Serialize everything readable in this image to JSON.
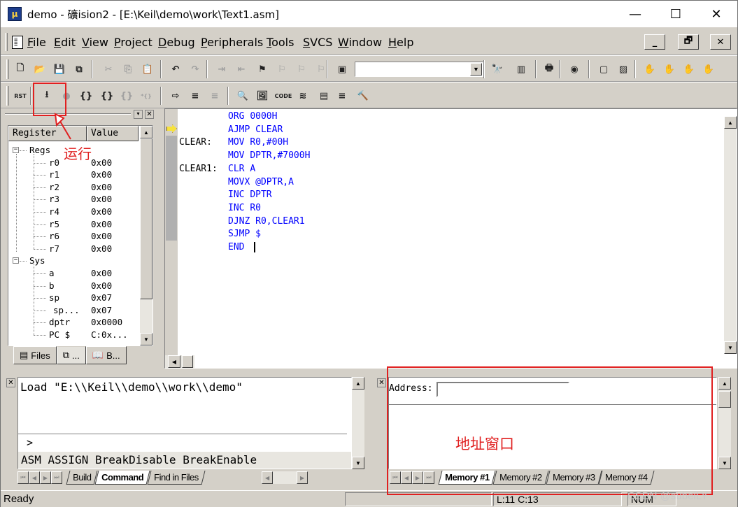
{
  "window": {
    "title": "demo  - 礦ision2 - [E:\\Keil\\demo\\work\\Text1.asm]",
    "icon_text": "µ",
    "minimize_glyph": "—",
    "maximize_glyph": "☐",
    "close_glyph": "✕"
  },
  "menu": {
    "items": [
      "File",
      "Edit",
      "View",
      "Project",
      "Debug",
      "Peripherals",
      "Tools",
      "SVCS",
      "Window",
      "Help"
    ],
    "mdi_buttons": [
      "_",
      "🗗",
      "✕"
    ]
  },
  "toolbar1": {
    "icons": [
      "new-file-icon",
      "open-folder-icon",
      "save-icon",
      "save-all-icon",
      "cut-icon",
      "copy-icon",
      "paste-icon",
      "undo-icon",
      "redo-icon",
      "indent-icon",
      "unindent-icon",
      "bookmark-toggle-icon",
      "bookmark-prev-icon",
      "bookmark-next-icon",
      "bookmark-clear-icon",
      "find-in-files-icon",
      "find-icon",
      "view-doc-icon",
      "print-icon",
      "debug-start-icon",
      "window-view-icon",
      "window-float-icon",
      "hand-icon",
      "hand-stop-icon",
      "hand-dis-icon",
      "hand-all-icon"
    ],
    "glyphs": [
      "🗋",
      "📂",
      "💾",
      "⧉",
      "✂",
      "⎘",
      "📋",
      "↶",
      "↷",
      "⇥",
      "⇤",
      "⚑",
      "⚐",
      "⚐",
      "⚐",
      "▣",
      "🔭",
      "▥",
      "🖶",
      "◉",
      "▢",
      "▨",
      "✋",
      "✋",
      "✋",
      "✋"
    ],
    "find_combo_value": ""
  },
  "toolbar2": {
    "icons": [
      "reset-cpu-icon",
      "run-icon",
      "stop-icon",
      "step-into-icon",
      "step-over-icon",
      "step-out-icon",
      "run-to-cursor-icon",
      "show-next-statement-icon",
      "enable-trace-icon",
      "view-trace-icon",
      "disassembly-icon",
      "watch-icon",
      "code-coverage-icon",
      "performance-icon",
      "memory-window-icon",
      "serial-window-icon",
      "toolbox-icon"
    ],
    "glyphs": [
      "RST",
      "⭳",
      "●",
      "{}",
      "{}",
      "{}",
      "*{}",
      "⇨",
      "≡",
      "≡",
      "🔍",
      "🖼",
      "CODE",
      "≋",
      "▤",
      "≡",
      "🔨"
    ]
  },
  "registers": {
    "columns": [
      "Register",
      "Value"
    ],
    "groups": [
      {
        "name": "Regs",
        "expander": "−",
        "items": [
          {
            "name": "r0",
            "value": "0x00"
          },
          {
            "name": "r1",
            "value": "0x00"
          },
          {
            "name": "r2",
            "value": "0x00"
          },
          {
            "name": "r3",
            "value": "0x00"
          },
          {
            "name": "r4",
            "value": "0x00"
          },
          {
            "name": "r5",
            "value": "0x00"
          },
          {
            "name": "r6",
            "value": "0x00"
          },
          {
            "name": "r7",
            "value": "0x00"
          }
        ]
      },
      {
        "name": "Sys",
        "expander": "−",
        "items": [
          {
            "name": "a",
            "value": "0x00"
          },
          {
            "name": "b",
            "value": "0x00"
          },
          {
            "name": "sp",
            "value": "0x07"
          },
          {
            "name": "sp...",
            "value": "0x07"
          },
          {
            "name": "dptr",
            "value": "0x0000"
          },
          {
            "name": "PC  $",
            "value": "C:0x..."
          }
        ]
      }
    ],
    "tabs": [
      {
        "label": "Files",
        "icon": "files-icon",
        "glyph": "▤"
      },
      {
        "label": "...",
        "icon": "registers-icon",
        "glyph": "⧉"
      },
      {
        "label": "B...",
        "icon": "books-icon",
        "glyph": "📖"
      }
    ]
  },
  "editor": {
    "lines": [
      {
        "label": "",
        "op": "ORG",
        "args": "0000H"
      },
      {
        "label": "",
        "op": "AJMP",
        "args": "CLEAR"
      },
      {
        "label": "CLEAR:",
        "op": "MOV",
        "args": "R0,#00H"
      },
      {
        "label": "",
        "op": "MOV",
        "args": "DPTR,#7000H"
      },
      {
        "label": "CLEAR1:",
        "op": "CLR",
        "args": "A"
      },
      {
        "label": "",
        "op": "MOVX",
        "args": "@DPTR,A"
      },
      {
        "label": "",
        "op": "INC",
        "args": "DPTR"
      },
      {
        "label": "",
        "op": "INC",
        "args": "R0"
      },
      {
        "label": "",
        "op": "DJNZ",
        "args": "R0,CLEAR1"
      },
      {
        "label": "",
        "op": "SJMP",
        "args": "$"
      },
      {
        "label": "",
        "op": "END",
        "args": ""
      }
    ],
    "current_line_index": 1
  },
  "output": {
    "text": "Load \"E:\\\\Keil\\\\demo\\\\work\\\\demo\"",
    "prompt": ">",
    "hint": "ASM ASSIGN BreakDisable BreakEnable",
    "tabs": [
      "Build",
      "Command",
      "Find in Files"
    ],
    "active_tab": "Command"
  },
  "memory": {
    "address_label": "Address:",
    "address_value": "",
    "tabs": [
      "Memory #1",
      "Memory #2",
      "Memory #3",
      "Memory #4"
    ],
    "active_tab": "Memory #1"
  },
  "status": {
    "ready": "Ready",
    "position": "L:11 C:13",
    "num": "NUM"
  },
  "annotations": {
    "run_label": "运行",
    "address_window_label": "地址窗口",
    "annotation_color": "#e02020"
  },
  "watermark": "CSDN @subeiLY"
}
